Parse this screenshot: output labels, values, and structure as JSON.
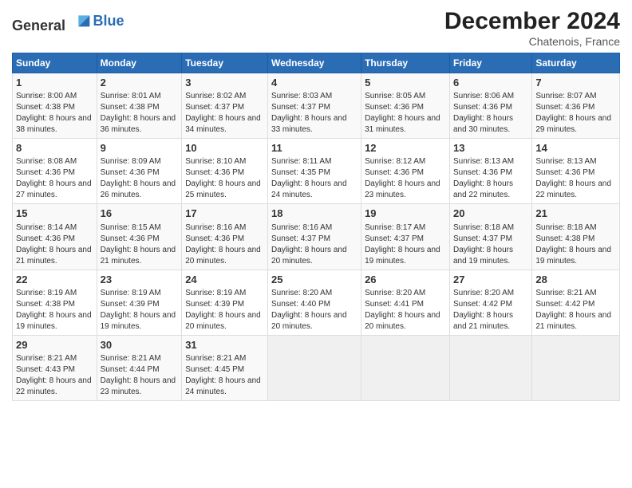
{
  "header": {
    "logo_general": "General",
    "logo_blue": "Blue",
    "month_title": "December 2024",
    "subtitle": "Chatenois, France"
  },
  "days_of_week": [
    "Sunday",
    "Monday",
    "Tuesday",
    "Wednesday",
    "Thursday",
    "Friday",
    "Saturday"
  ],
  "weeks": [
    [
      {
        "day": "1",
        "sunrise": "Sunrise: 8:00 AM",
        "sunset": "Sunset: 4:38 PM",
        "daylight": "Daylight: 8 hours and 38 minutes."
      },
      {
        "day": "2",
        "sunrise": "Sunrise: 8:01 AM",
        "sunset": "Sunset: 4:38 PM",
        "daylight": "Daylight: 8 hours and 36 minutes."
      },
      {
        "day": "3",
        "sunrise": "Sunrise: 8:02 AM",
        "sunset": "Sunset: 4:37 PM",
        "daylight": "Daylight: 8 hours and 34 minutes."
      },
      {
        "day": "4",
        "sunrise": "Sunrise: 8:03 AM",
        "sunset": "Sunset: 4:37 PM",
        "daylight": "Daylight: 8 hours and 33 minutes."
      },
      {
        "day": "5",
        "sunrise": "Sunrise: 8:05 AM",
        "sunset": "Sunset: 4:36 PM",
        "daylight": "Daylight: 8 hours and 31 minutes."
      },
      {
        "day": "6",
        "sunrise": "Sunrise: 8:06 AM",
        "sunset": "Sunset: 4:36 PM",
        "daylight": "Daylight: 8 hours and 30 minutes."
      },
      {
        "day": "7",
        "sunrise": "Sunrise: 8:07 AM",
        "sunset": "Sunset: 4:36 PM",
        "daylight": "Daylight: 8 hours and 29 minutes."
      }
    ],
    [
      {
        "day": "8",
        "sunrise": "Sunrise: 8:08 AM",
        "sunset": "Sunset: 4:36 PM",
        "daylight": "Daylight: 8 hours and 27 minutes."
      },
      {
        "day": "9",
        "sunrise": "Sunrise: 8:09 AM",
        "sunset": "Sunset: 4:36 PM",
        "daylight": "Daylight: 8 hours and 26 minutes."
      },
      {
        "day": "10",
        "sunrise": "Sunrise: 8:10 AM",
        "sunset": "Sunset: 4:36 PM",
        "daylight": "Daylight: 8 hours and 25 minutes."
      },
      {
        "day": "11",
        "sunrise": "Sunrise: 8:11 AM",
        "sunset": "Sunset: 4:35 PM",
        "daylight": "Daylight: 8 hours and 24 minutes."
      },
      {
        "day": "12",
        "sunrise": "Sunrise: 8:12 AM",
        "sunset": "Sunset: 4:36 PM",
        "daylight": "Daylight: 8 hours and 23 minutes."
      },
      {
        "day": "13",
        "sunrise": "Sunrise: 8:13 AM",
        "sunset": "Sunset: 4:36 PM",
        "daylight": "Daylight: 8 hours and 22 minutes."
      },
      {
        "day": "14",
        "sunrise": "Sunrise: 8:13 AM",
        "sunset": "Sunset: 4:36 PM",
        "daylight": "Daylight: 8 hours and 22 minutes."
      }
    ],
    [
      {
        "day": "15",
        "sunrise": "Sunrise: 8:14 AM",
        "sunset": "Sunset: 4:36 PM",
        "daylight": "Daylight: 8 hours and 21 minutes."
      },
      {
        "day": "16",
        "sunrise": "Sunrise: 8:15 AM",
        "sunset": "Sunset: 4:36 PM",
        "daylight": "Daylight: 8 hours and 21 minutes."
      },
      {
        "day": "17",
        "sunrise": "Sunrise: 8:16 AM",
        "sunset": "Sunset: 4:36 PM",
        "daylight": "Daylight: 8 hours and 20 minutes."
      },
      {
        "day": "18",
        "sunrise": "Sunrise: 8:16 AM",
        "sunset": "Sunset: 4:37 PM",
        "daylight": "Daylight: 8 hours and 20 minutes."
      },
      {
        "day": "19",
        "sunrise": "Sunrise: 8:17 AM",
        "sunset": "Sunset: 4:37 PM",
        "daylight": "Daylight: 8 hours and 19 minutes."
      },
      {
        "day": "20",
        "sunrise": "Sunrise: 8:18 AM",
        "sunset": "Sunset: 4:37 PM",
        "daylight": "Daylight: 8 hours and 19 minutes."
      },
      {
        "day": "21",
        "sunrise": "Sunrise: 8:18 AM",
        "sunset": "Sunset: 4:38 PM",
        "daylight": "Daylight: 8 hours and 19 minutes."
      }
    ],
    [
      {
        "day": "22",
        "sunrise": "Sunrise: 8:19 AM",
        "sunset": "Sunset: 4:38 PM",
        "daylight": "Daylight: 8 hours and 19 minutes."
      },
      {
        "day": "23",
        "sunrise": "Sunrise: 8:19 AM",
        "sunset": "Sunset: 4:39 PM",
        "daylight": "Daylight: 8 hours and 19 minutes."
      },
      {
        "day": "24",
        "sunrise": "Sunrise: 8:19 AM",
        "sunset": "Sunset: 4:39 PM",
        "daylight": "Daylight: 8 hours and 20 minutes."
      },
      {
        "day": "25",
        "sunrise": "Sunrise: 8:20 AM",
        "sunset": "Sunset: 4:40 PM",
        "daylight": "Daylight: 8 hours and 20 minutes."
      },
      {
        "day": "26",
        "sunrise": "Sunrise: 8:20 AM",
        "sunset": "Sunset: 4:41 PM",
        "daylight": "Daylight: 8 hours and 20 minutes."
      },
      {
        "day": "27",
        "sunrise": "Sunrise: 8:20 AM",
        "sunset": "Sunset: 4:42 PM",
        "daylight": "Daylight: 8 hours and 21 minutes."
      },
      {
        "day": "28",
        "sunrise": "Sunrise: 8:21 AM",
        "sunset": "Sunset: 4:42 PM",
        "daylight": "Daylight: 8 hours and 21 minutes."
      }
    ],
    [
      {
        "day": "29",
        "sunrise": "Sunrise: 8:21 AM",
        "sunset": "Sunset: 4:43 PM",
        "daylight": "Daylight: 8 hours and 22 minutes."
      },
      {
        "day": "30",
        "sunrise": "Sunrise: 8:21 AM",
        "sunset": "Sunset: 4:44 PM",
        "daylight": "Daylight: 8 hours and 23 minutes."
      },
      {
        "day": "31",
        "sunrise": "Sunrise: 8:21 AM",
        "sunset": "Sunset: 4:45 PM",
        "daylight": "Daylight: 8 hours and 24 minutes."
      },
      null,
      null,
      null,
      null
    ]
  ]
}
